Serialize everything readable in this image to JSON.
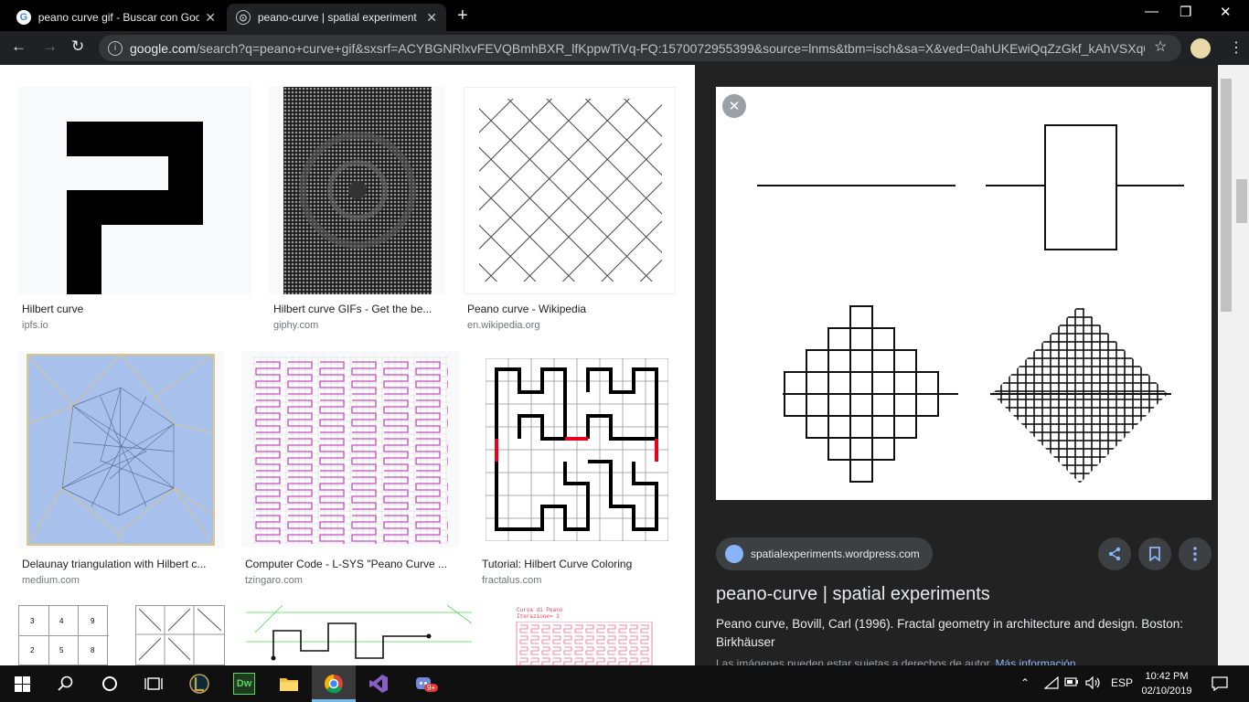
{
  "tabs": [
    {
      "title": "peano curve gif - Buscar con Goo",
      "favicon": "G"
    },
    {
      "title": "peano-curve | spatial experiment",
      "favicon": "⊙"
    }
  ],
  "new_tab": "+",
  "window_controls": {
    "minimize": "—",
    "maximize": "❐",
    "close": "✕"
  },
  "nav": {
    "back": "←",
    "forward": "→",
    "reload": "↻"
  },
  "address": {
    "host": "google.com",
    "path": "/search?q=peano+curve+gif&sxsrf=ACYBGNRlxvFEVQBmhBXR_lfKppwTiVq-FQ:1570072955399&source=lnms&tbm=isch&sa=X&ved=0ahUKEwiQqZzGkf_kAhVSXq0..."
  },
  "results": [
    {
      "title": "Hilbert curve",
      "source": "ipfs.io"
    },
    {
      "title": "Hilbert curve GIFs - Get the be...",
      "source": "giphy.com"
    },
    {
      "title": "Peano curve - Wikipedia",
      "source": "en.wikipedia.org"
    },
    {
      "title": "Delaunay triangulation with Hilbert c...",
      "source": "medium.com"
    },
    {
      "title": "Computer Code - L-SYS \"Peano Curve ...",
      "source": "tzingaro.com"
    },
    {
      "title": "Tutorial: Hilbert Curve Coloring",
      "source": "fractalus.com"
    }
  ],
  "row3": {
    "grid_numbers": [
      "3",
      "4",
      "9",
      "2",
      "5",
      "8"
    ],
    "peano_heading": "Curva di Peano",
    "peano_sub": "Iterazione= 3"
  },
  "panel": {
    "close": "✕",
    "source": "spatialexperiments.wordpress.com",
    "share": "share-icon",
    "save": "bookmark-icon",
    "more": "more-icon",
    "title": "peano-curve | spatial experiments",
    "description": "Peano curve, Bovill, Carl (1996). Fractal geometry in architecture and design. Boston: Birkhäuser",
    "note": "Las imágenes pueden estar sujetas a derechos de autor.",
    "note_link": "Más información"
  },
  "taskbar": {
    "lang": "ESP",
    "time": "10:42 PM",
    "date": "02/10/2019",
    "dw": "Dw",
    "badge": "9+"
  },
  "colors": {
    "accent": "#8ab4f8",
    "panel_bg": "#222222",
    "red": "#e8001e"
  }
}
